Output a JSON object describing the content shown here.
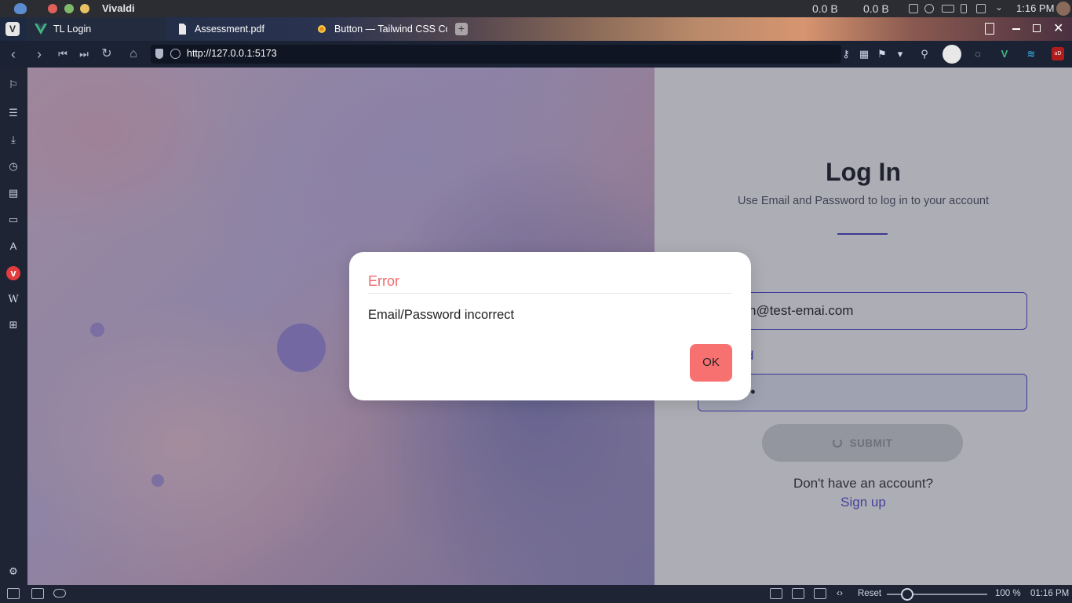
{
  "os": {
    "app_name": "Vivaldi",
    "net_down": "0.0 B",
    "net_up": "0.0 B",
    "time": "1:16 PM"
  },
  "tabs": [
    {
      "label": "TL Login",
      "active": true,
      "icon": "vue-icon"
    },
    {
      "label": "Assessment.pdf",
      "active": false,
      "icon": "document-icon"
    },
    {
      "label": "Button — Tailwind CSS Com",
      "active": false,
      "icon": "sun-icon"
    }
  ],
  "address": {
    "url": "http://127.0.0.1:5173"
  },
  "page": {
    "login_title": "Log In",
    "login_subtitle": "Use Email and Password to log in to your account",
    "email_value": "n@test-emai.com",
    "password_label": "rd",
    "password_value": "••",
    "submit_label": "SUBMIT",
    "no_account_text": "Don't have an account?",
    "signup_link": "Sign up"
  },
  "dialog": {
    "title": "Error",
    "message": "Email/Password incorrect",
    "ok_label": "OK"
  },
  "statusbar": {
    "reset_label": "Reset",
    "zoom_percent": "100 %",
    "zoom_value": 100,
    "time": "01:16 PM"
  },
  "colors": {
    "accent": "#4a3fd0",
    "error_title": "#ef6a6a",
    "ok_button": "#f87171"
  }
}
